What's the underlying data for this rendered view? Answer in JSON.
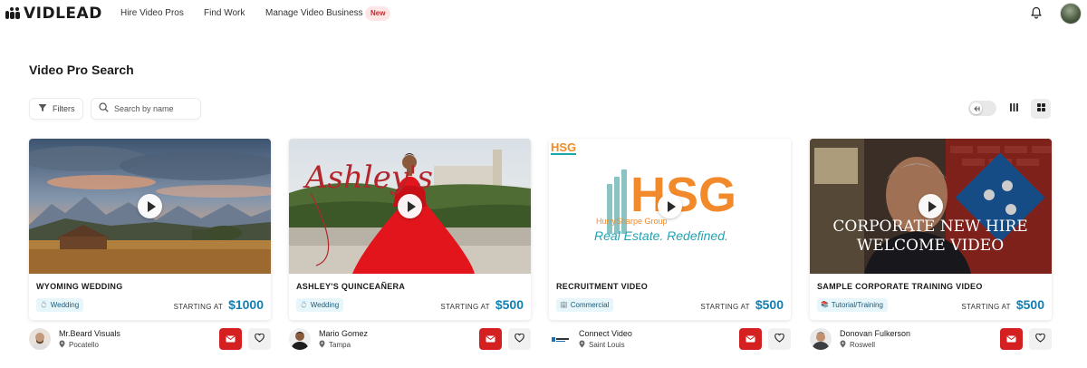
{
  "brand": {
    "name": "VIDLEAD",
    "logo_icon": "film-cells-icon"
  },
  "nav": {
    "links": [
      {
        "label": "Hire Video Pros"
      },
      {
        "label": "Find Work"
      },
      {
        "label": "Manage Video Business"
      }
    ],
    "new_badge": "New",
    "notifications_icon": "bell-icon",
    "profile_icon": "user-avatar"
  },
  "page": {
    "title": "Video Pro Search"
  },
  "toolbar": {
    "filters_label": "Filters",
    "filters_icon": "funnel-icon",
    "search_icon": "search-icon",
    "search_placeholder": "Search by name",
    "search_value": "",
    "toggle_icon": "arrow-left-icon",
    "view_list_icon": "columns-icon",
    "view_grid_icon": "grid-icon",
    "active_view": "grid"
  },
  "colors": {
    "accent_blue": "#117fb1",
    "mail_red": "#d42020",
    "tag_bg": "#e6f6fb"
  },
  "price_label": "STARTING AT",
  "cards": [
    {
      "title": "WYOMING WEDDING",
      "category": "Wedding",
      "category_icon": "rings-icon",
      "price": "$1000",
      "owner": "Mr.Beard Visuals",
      "location": "Pocatello",
      "thumbnail": "mountain-barn-landscape"
    },
    {
      "title": "ASHLEY'S QUINCEAÑERA",
      "category": "Wedding",
      "category_icon": "rings-icon",
      "price": "$500",
      "owner": "Mario Gomez",
      "location": "Tampa",
      "thumbnail": "quinceanera-red-dress",
      "overlay_text": "Ashley's"
    },
    {
      "title": "RECRUITMENT VIDEO",
      "category": "Commercial",
      "category_icon": "building-icon",
      "price": "$500",
      "owner": "Connect Video",
      "location": "Saint Louis",
      "thumbnail": "hsg-logo",
      "overlay_text": "HSG",
      "overlay_company": "HurrySharpe Group",
      "overlay_slogan": "Real Estate. Redefined."
    },
    {
      "title": "SAMPLE CORPORATE TRAINING VIDEO",
      "category": "Tutorial/Training",
      "category_icon": "book-icon",
      "price": "$500",
      "owner": "Donovan Fulkerson",
      "location": "Roswell",
      "thumbnail": "corporate-presenter",
      "overlay_text_line1": "CORPORATE NEW HIRE",
      "overlay_text_line2": "WELCOME VIDEO"
    }
  ]
}
